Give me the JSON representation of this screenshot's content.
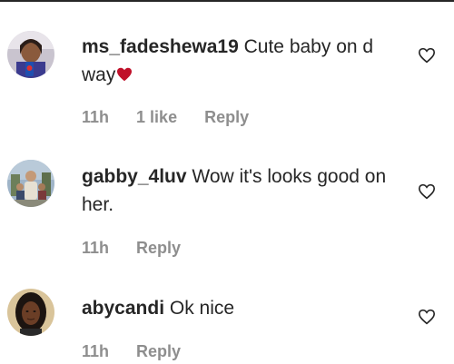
{
  "comments": [
    {
      "username": "ms_fadeshewa19",
      "text": "Cute baby on d way",
      "emoji": "heart-red",
      "time": "11h",
      "likes": "1 like",
      "reply_label": "Reply"
    },
    {
      "username": "gabby_4luv",
      "text": "Wow it's looks good on her.",
      "time": "11h",
      "reply_label": "Reply"
    },
    {
      "username": "abycandi",
      "text": "Ok nice",
      "time": "11h",
      "reply_label": "Reply"
    }
  ],
  "colors": {
    "text": "#262626",
    "meta": "#8e8e8e",
    "emoji_heart": "#c0102a"
  }
}
